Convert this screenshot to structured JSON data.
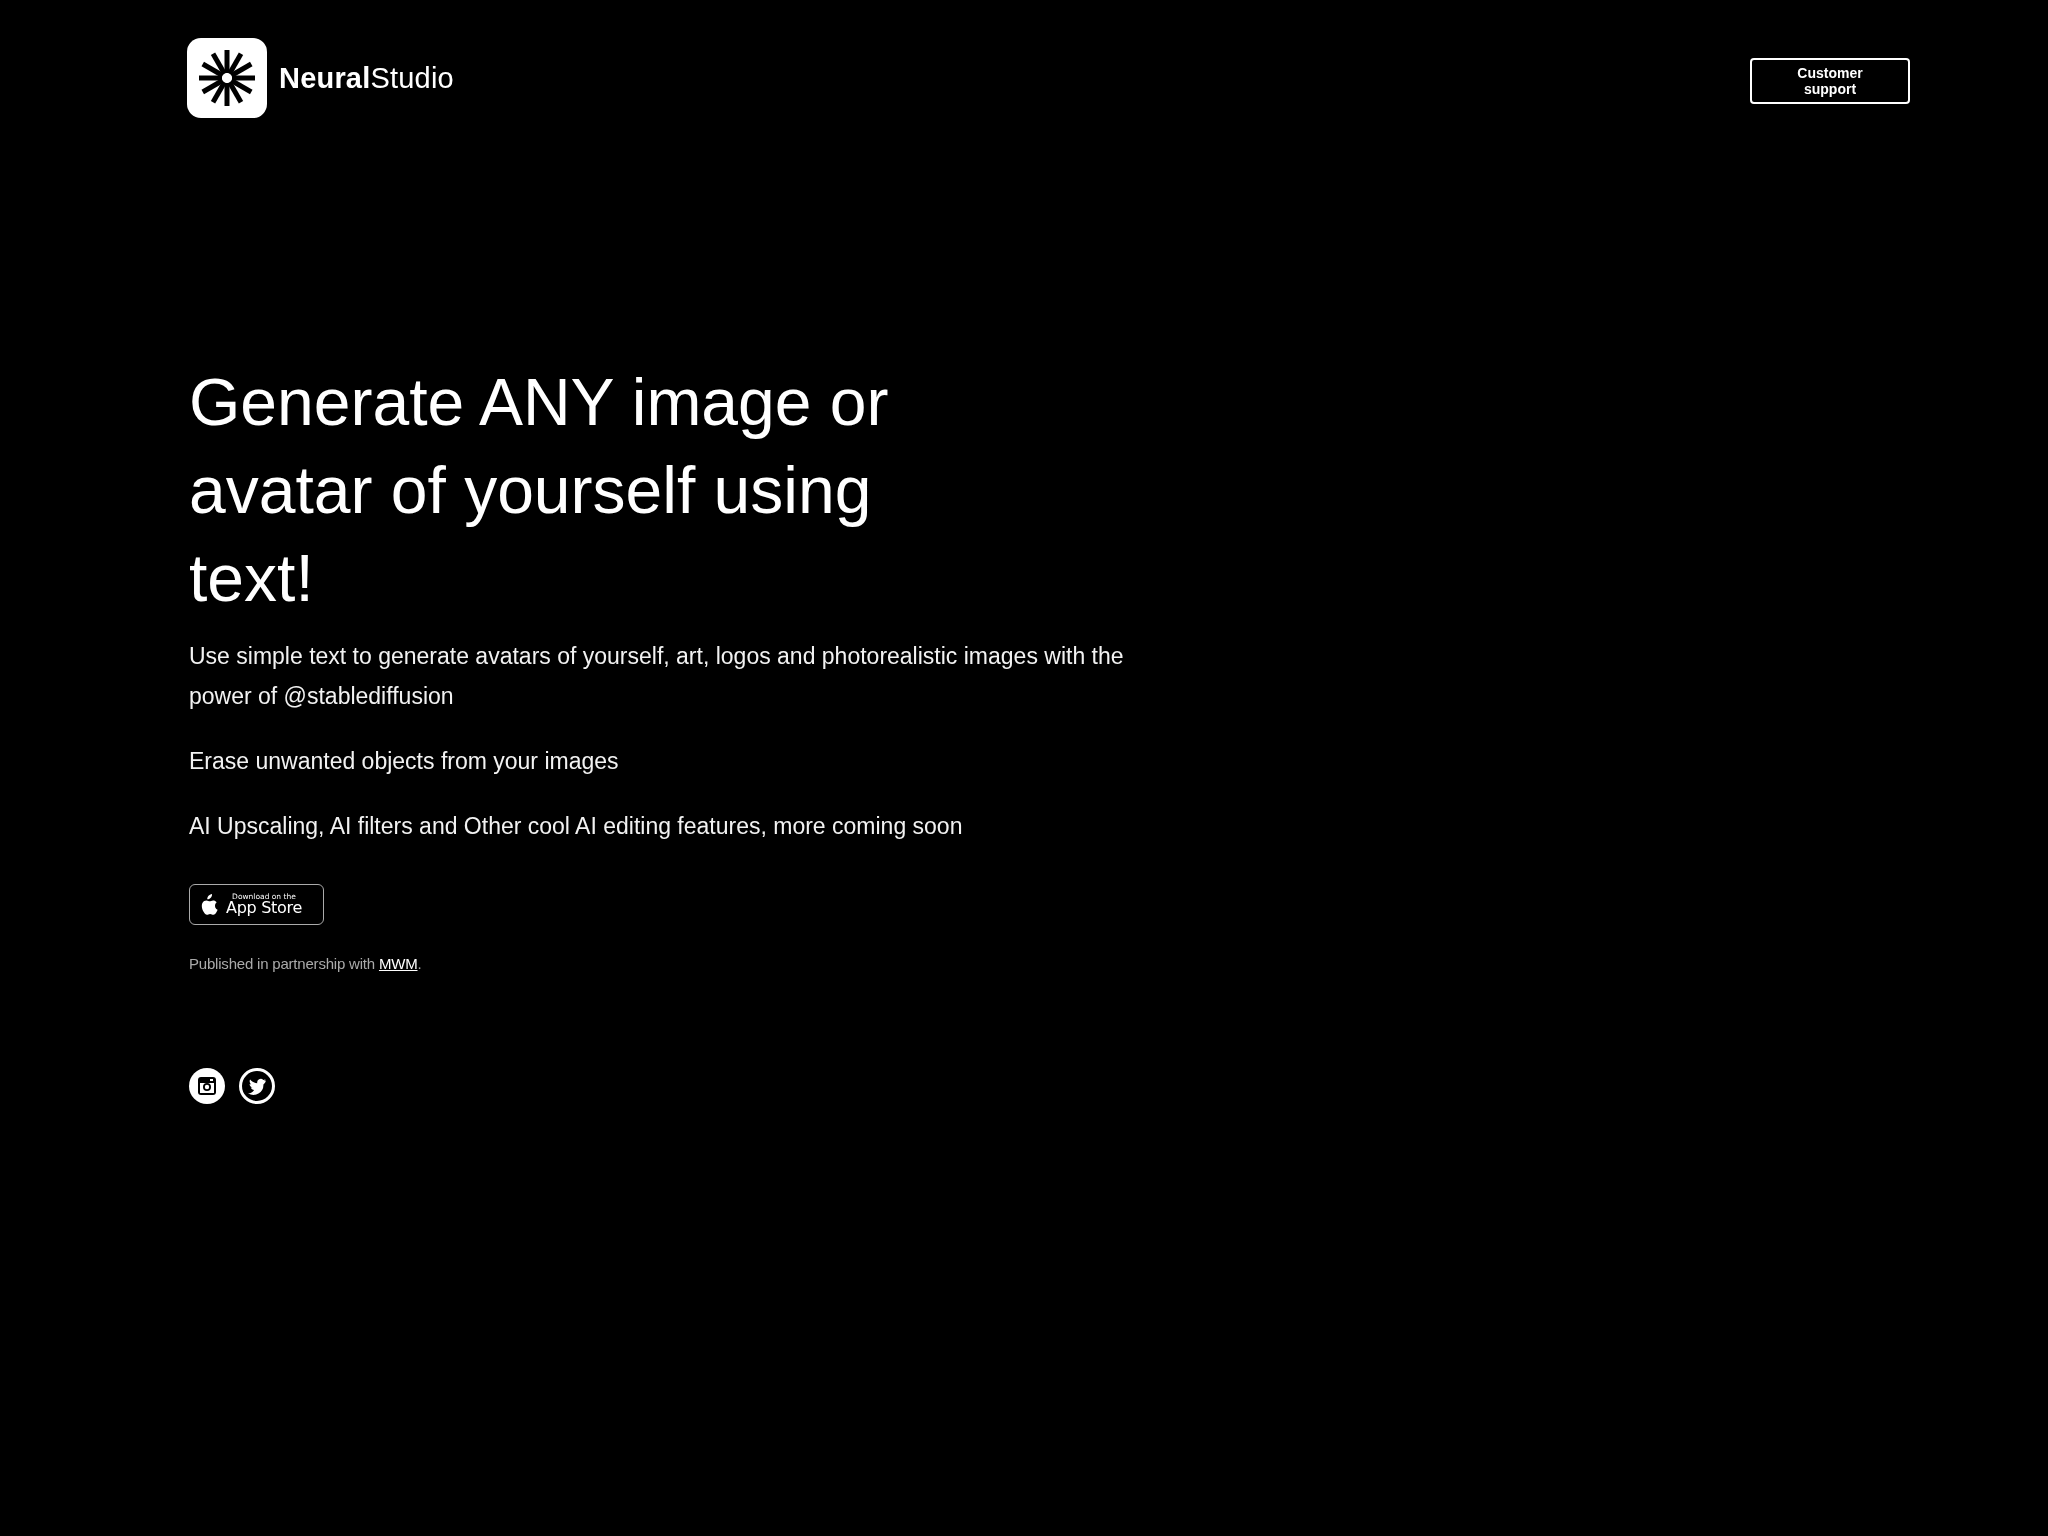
{
  "header": {
    "brand": "**Neural**Studio",
    "support_button": "Customer support"
  },
  "hero": {
    "headline": "Generate ANY image or avatar of yourself using text!",
    "paragraphs": [
      "Use simple text to generate avatars of yourself, art, logos and photorealistic images with the power of @stablediffusion",
      "Erase unwanted objects from your images",
      "AI Upscaling, AI filters and Other cool AI editing features, more coming soon"
    ]
  },
  "app_store_badge": {
    "small_text": "Download on the",
    "large_text": "App Store"
  },
  "partnership": {
    "text": "Published in partnership with ",
    "link": "MWM",
    "suffix": "."
  },
  "social_links": [
    {
      "kind": "instagram"
    },
    {
      "kind": "twitter"
    }
  ]
}
